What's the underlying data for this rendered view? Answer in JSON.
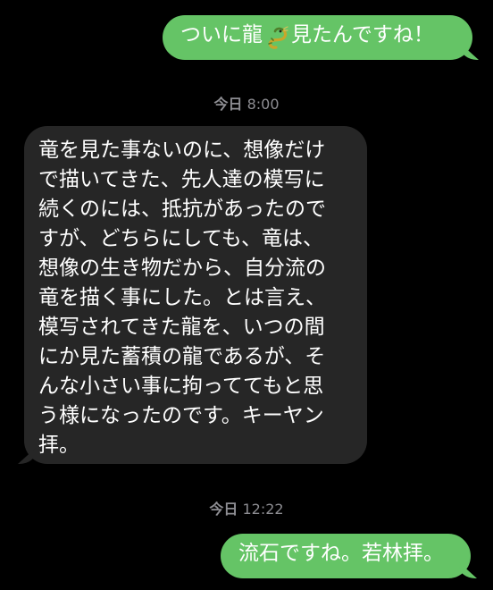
{
  "theme": {
    "background": "#000000",
    "sent_bubble": "#65c466",
    "received_bubble": "#262626",
    "timestamp_color": "#8e8e93"
  },
  "messages": [
    {
      "direction": "sent",
      "text_before": "ついに龍",
      "emoji": "dragon-icon",
      "text_after": "見たんですね！"
    },
    {
      "timestamp_day": "今日",
      "timestamp_time": "8:00"
    },
    {
      "direction": "received",
      "lines": [
        "竜を見た事ないのに、想像だけ",
        "で描いてきた、先人達の模写に",
        "続くのには、抵抗があったので",
        "すが、どちらにしても、竜は、",
        "想像の生き物だから、自分流の",
        "竜を描く事にした。とは言え、",
        "模写されてきた龍を、いつの間",
        "にか見た蓄積の龍であるが、そ",
        "んな小さい事に拘っててもと思",
        "う様になったのです。キーヤン",
        "拝。"
      ]
    },
    {
      "timestamp_day": "今日",
      "timestamp_time": "12:22"
    },
    {
      "direction": "sent",
      "text": "流石ですね。若林拝。"
    }
  ]
}
